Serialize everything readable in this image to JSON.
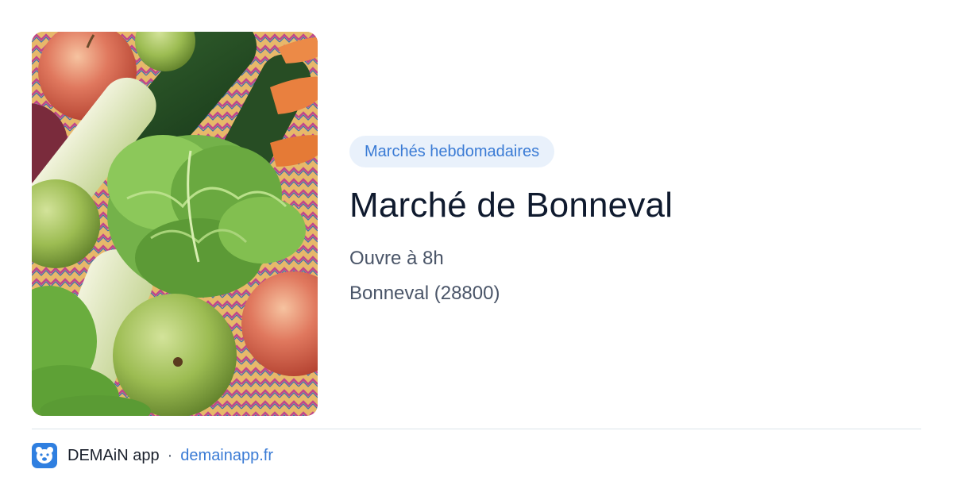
{
  "hero": {
    "image": {
      "alt": "Fresh vegetables and fruits: apples, pears, lettuce, leeks, cucumbers, carrots"
    }
  },
  "market": {
    "category": "Marchés hebdomadaires",
    "title": "Marché de Bonneval",
    "opening": "Ouvre à 8h",
    "location": "Bonneval (28800)"
  },
  "footer": {
    "app_icon": "bear-logo-icon",
    "app_name": "DEMAiN app",
    "separator": "·",
    "domain": "demainapp.fr"
  },
  "colors": {
    "accent": "#3a7bd5",
    "tag_background": "#e9f1fb",
    "title": "#0f1a2e",
    "meta_text": "#4a5568",
    "app_icon_background": "#2f7fe0"
  }
}
